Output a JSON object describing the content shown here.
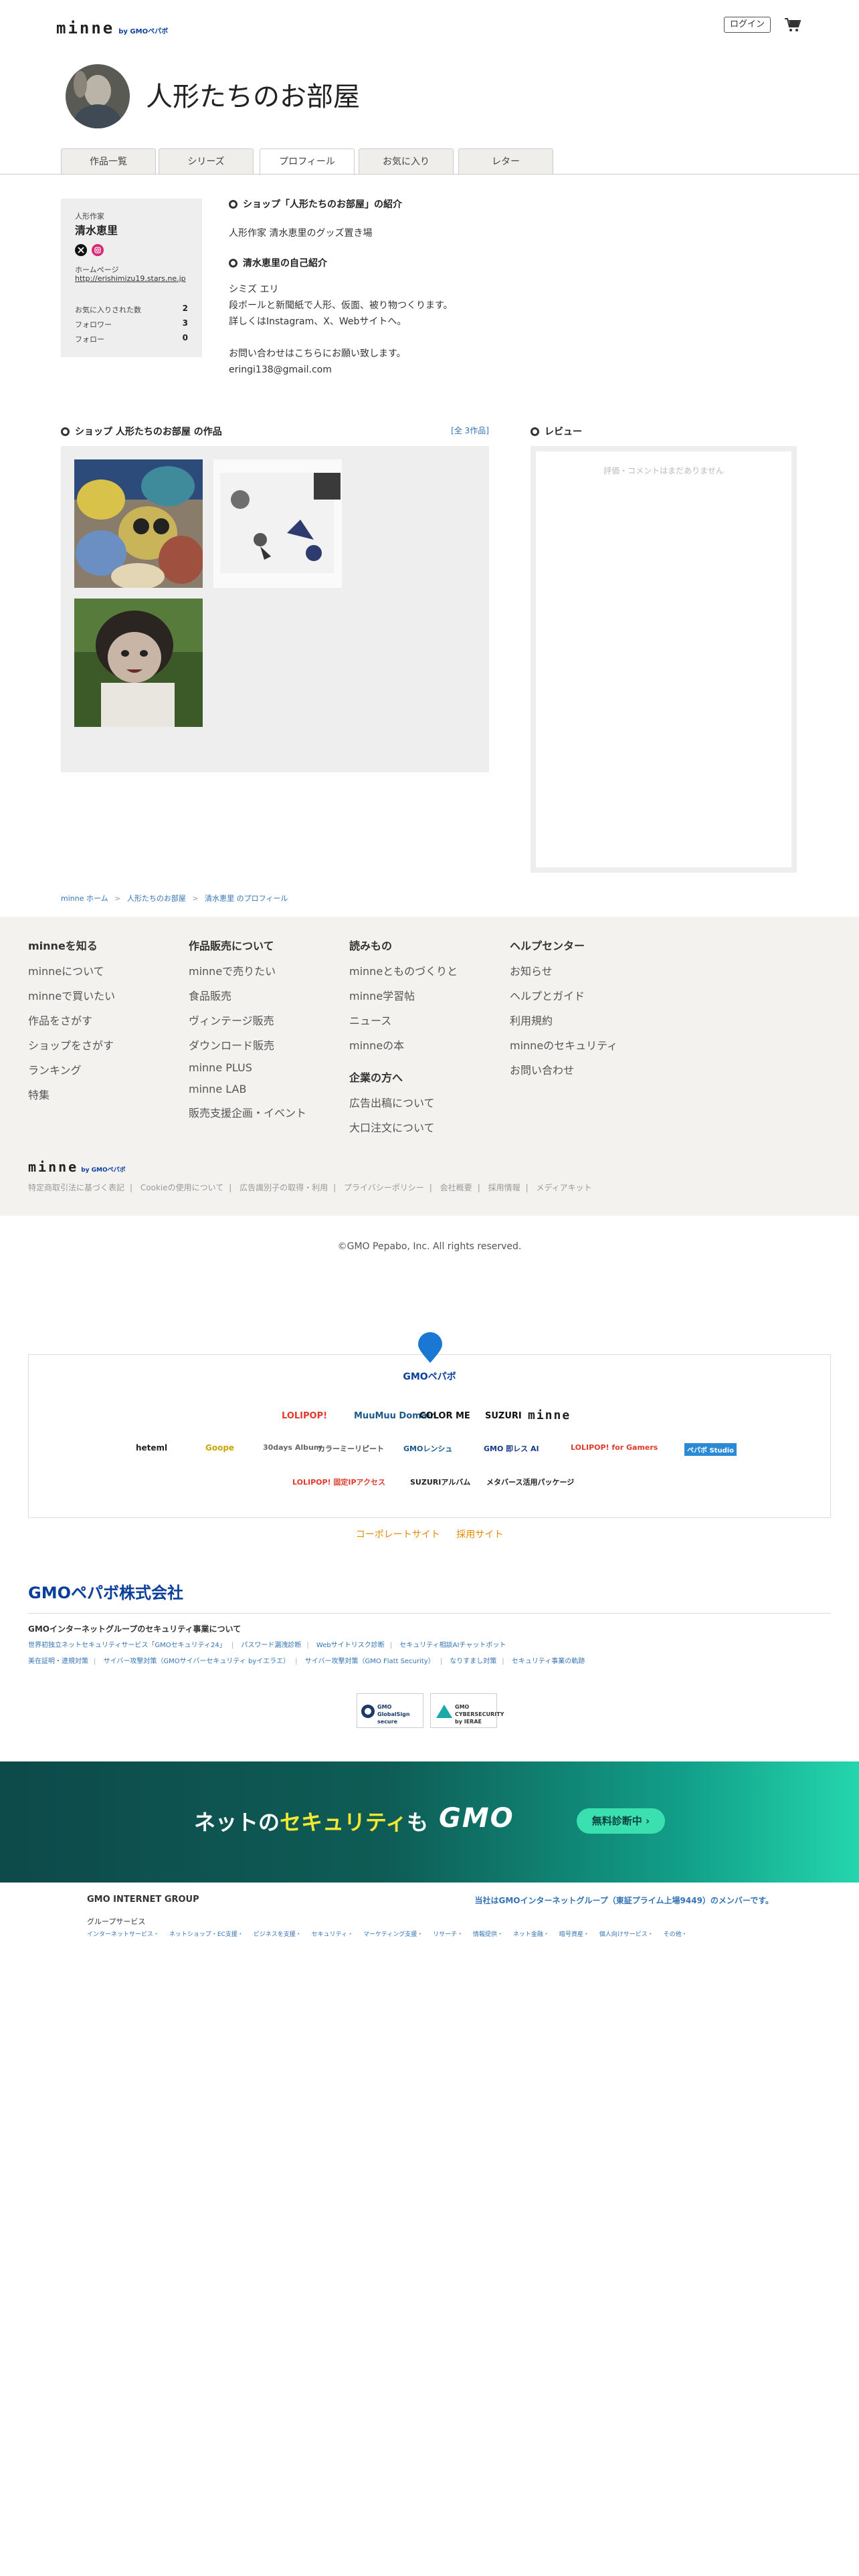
{
  "header": {
    "logo": "minne",
    "logo_by": "by GMOペパボ",
    "login_label": "ログイン"
  },
  "shop": {
    "title": "人形たちのお部屋"
  },
  "tabs": [
    "作品一覧",
    "シリーズ",
    "プロフィール",
    "お気に入り",
    "レター"
  ],
  "active_tab": "プロフィール",
  "profile_card": {
    "role": "人形作家",
    "name": "清水恵里",
    "homepage_label": "ホームページ",
    "homepage_url": "http://erishimizu19.stars.ne.jp",
    "stats": [
      {
        "label": "お気に入りされた数",
        "value": "2"
      },
      {
        "label": "フォロワー",
        "value": "3"
      },
      {
        "label": "フォロー",
        "value": "0"
      }
    ]
  },
  "intro": {
    "shop_heading": "ショップ「人形たちのお部屋」の紹介",
    "shop_text": "人形作家 清水恵里のグッズ置き場",
    "self_heading": "清水恵里の自己紹介",
    "self_lines": [
      "シミズ エリ",
      "段ボールと新聞紙で人形、仮面、被り物つくります。",
      "詳しくはInstagram、X、Webサイトへ。",
      "",
      "お問い合わせはこちらにお願い致します。",
      "eringi138@gmail.com"
    ]
  },
  "works": {
    "heading": "ショップ 人形たちのお部屋 の作品",
    "count": "[全 3作品]"
  },
  "reviews": {
    "heading": "レビュー",
    "empty": "評価・コメントはまだありません"
  },
  "breadcrumb": [
    "minne ホーム",
    "人形たちのお部屋",
    "清水恵里 のプロフィール"
  ],
  "footer": {
    "col1": {
      "heading": "minneを知る",
      "items": [
        "minneについて",
        "minneで買いたい",
        "作品をさがす",
        "ショップをさがす",
        "ランキング",
        "特集"
      ]
    },
    "col2": {
      "heading": "作品販売について",
      "items": [
        "minneで売りたい",
        "食品販売",
        "ヴィンテージ販売",
        "ダウンロード販売",
        "minne PLUS",
        "minne LAB",
        "販売支援企画・イベント"
      ]
    },
    "col3": {
      "heading": "読みもの",
      "items": [
        "minneとものづくりと",
        "minne学習帖",
        "ニュース",
        "minneの本"
      ]
    },
    "col3b": {
      "heading": "企業の方へ",
      "items": [
        "広告出稿について",
        "大口注文について"
      ]
    },
    "col4": {
      "heading": "ヘルプセンター",
      "items": [
        "お知らせ",
        "ヘルプとガイド",
        "利用規約",
        "minneのセキュリティ",
        "お問い合わせ"
      ]
    },
    "logo": "minne",
    "logo_by": "by GMOペパボ",
    "links": [
      "特定商取引法に基づく表記",
      "Cookieの使用について",
      "広告識別子の取得・利用",
      "プライバシーポリシー",
      "会社概要",
      "採用情報",
      "メディアキット"
    ]
  },
  "copyright": "©GMO Pepabo, Inc. All rights reserved.",
  "brands": {
    "pepabo": "GMOペパボ",
    "row1": [
      "LOLIPOP!",
      "MuuMuu Domain",
      "COLOR ME",
      "SUZURI",
      "minne"
    ],
    "row2": [
      "heteml",
      "Goope",
      "30days Album",
      "カラーミーリピート",
      "GMOレンシュ",
      "GMO 即レス AI",
      "LOLIPOP! for Gamers",
      "ペパボ Studio"
    ],
    "row3": [
      "LOLIPOP! 固定IPアクセス",
      "SUZURIアルバム",
      "メタバース活用パッケージ"
    ]
  },
  "corp_links": [
    "コーポレートサイト",
    "採用サイト"
  ],
  "security": {
    "company": "GMOペパボ株式会社",
    "title": "GMOインターネットグループのセキュリティ事業について",
    "row1": [
      "世界初独立ネットセキュリティサービス「GMOセキュリティ24」",
      "パスワード漏洩診断",
      "Webサイトリスク診断",
      "セキュリティ相談AIチャットボット"
    ],
    "row2": [
      "美在証明・違規対策",
      "サイバー攻撃対策（GMOサイバーセキュリティ byイエラエ）",
      "サイバー攻撃対策（GMO Flatt Security）",
      "なりすまし対策",
      "セキュリティ事業の軌跡"
    ],
    "seal1": "GMO GlobalSign secure",
    "seal2": "GMO CYBERSECURITY by IERAE"
  },
  "banner": {
    "text_pre": "ネットの",
    "text_hl": "セキュリティ",
    "text_post": "も",
    "brand": "GMO",
    "button": "無料診断中 ›"
  },
  "gmo_group": {
    "name": "GMO INTERNET GROUP",
    "member": "当社はGMOインターネットグループ（東証プライム上場9449）のメンバーです。",
    "services_label": "グループサービス",
    "services": [
      "インターネットサービス・",
      "ネットショップ・EC支援・",
      "ビジネスを支援・",
      "セキュリティ・",
      "マーケティング支援・",
      "リサーチ・",
      "情報提供・",
      "ネット金融・",
      "暗号資産・",
      "個人向けサービス・",
      "その他・"
    ]
  },
  "colors": {
    "accent": "#3373b4",
    "corp": "#e68a00",
    "pepabo": "#0b3f9c"
  }
}
